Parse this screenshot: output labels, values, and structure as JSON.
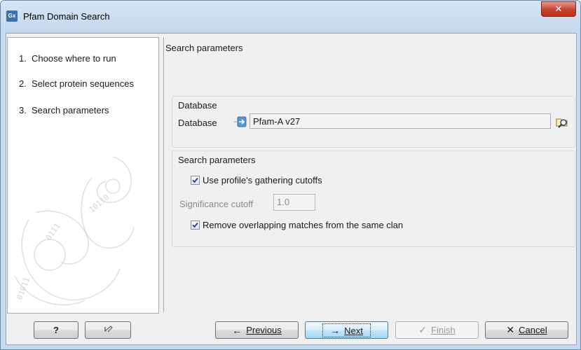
{
  "window": {
    "app_icon": "Gx",
    "title": "Pfam Domain Search",
    "close_glyph": "✕"
  },
  "wizard": {
    "steps": [
      {
        "num": "1.",
        "label": "Choose where to run"
      },
      {
        "num": "2.",
        "label": "Select protein sequences"
      },
      {
        "num": "3.",
        "label": "Search parameters"
      }
    ],
    "active_step": 3
  },
  "main": {
    "title": "Search parameters",
    "database_group": {
      "title": "Database",
      "label": "Database",
      "value": "Pfam-A v27"
    },
    "search_group": {
      "title": "Search parameters",
      "gathering_cutoffs": {
        "label": "Use profile's gathering cutoffs",
        "checked": true
      },
      "significance": {
        "label": "Significance cutoff",
        "value": "1.0",
        "enabled": false
      },
      "remove_overlapping": {
        "label": "Remove overlapping matches from the same clan",
        "checked": true
      }
    }
  },
  "footer": {
    "help": "?",
    "previous_icon": "←",
    "previous_label": "Previous",
    "next_icon": "→",
    "next_label": "Next",
    "finish_icon": "✓",
    "finish_label": "Finish",
    "cancel_icon": "✕",
    "cancel_label": "Cancel"
  },
  "colors": {
    "title_bar": "#c3d7ee",
    "close_button": "#c9402b",
    "default_button": "#bee6fd"
  }
}
